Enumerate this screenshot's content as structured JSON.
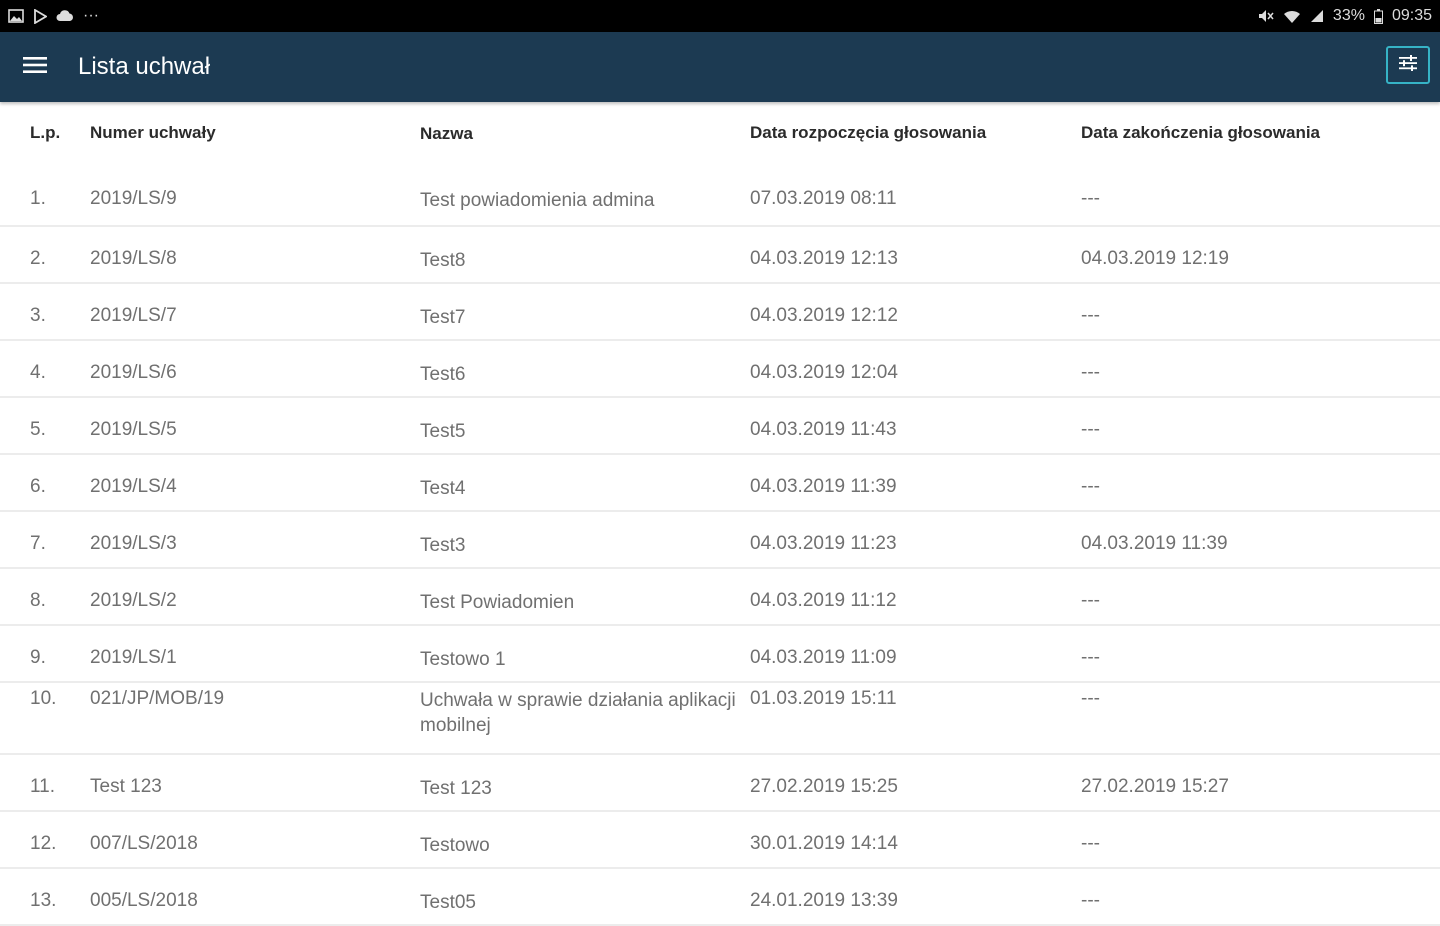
{
  "status_bar": {
    "left_icons": [
      "image-icon",
      "play-store-icon",
      "cloud-icon",
      "more-icon"
    ],
    "right_icons": [
      "mute-icon",
      "wifi-icon",
      "signal-icon"
    ],
    "battery": "33%",
    "time": "09:35",
    "more_glyph": "···"
  },
  "app_bar": {
    "title": "Lista uchwał",
    "background": "#1c3a52",
    "accent": "#36b3c6"
  },
  "table": {
    "headers": {
      "lp": "L.p.",
      "number": "Numer uchwały",
      "name": "Nazwa",
      "start": "Data rozpoczęcia głosowania",
      "end": "Data zakończenia głosowania"
    },
    "rows": [
      {
        "lp": "1.",
        "number": "2019/LS/9",
        "name": "Test powiadomienia admina",
        "start": "07.03.2019 08:11",
        "end": "---"
      },
      {
        "lp": "2.",
        "number": "2019/LS/8",
        "name": "Test8",
        "start": "04.03.2019 12:13",
        "end": "04.03.2019 12:19"
      },
      {
        "lp": "3.",
        "number": "2019/LS/7",
        "name": "Test7",
        "start": "04.03.2019 12:12",
        "end": "---"
      },
      {
        "lp": "4.",
        "number": "2019/LS/6",
        "name": "Test6",
        "start": "04.03.2019 12:04",
        "end": "---"
      },
      {
        "lp": "5.",
        "number": "2019/LS/5",
        "name": "Test5",
        "start": "04.03.2019 11:43",
        "end": "---"
      },
      {
        "lp": "6.",
        "number": "2019/LS/4",
        "name": "Test4",
        "start": "04.03.2019 11:39",
        "end": "---"
      },
      {
        "lp": "7.",
        "number": "2019/LS/3",
        "name": "Test3",
        "start": "04.03.2019 11:23",
        "end": "04.03.2019 11:39"
      },
      {
        "lp": "8.",
        "number": "2019/LS/2",
        "name": "Test Powiadomien",
        "start": "04.03.2019 11:12",
        "end": "---"
      },
      {
        "lp": "9.",
        "number": "2019/LS/1",
        "name": "Testowo 1",
        "start": "04.03.2019 11:09",
        "end": "---"
      },
      {
        "lp": "10.",
        "number": "021/JP/MOB/19",
        "name": "Uchwała w sprawie działania aplikacji mobilnej",
        "start": "01.03.2019 15:11",
        "end": "---"
      },
      {
        "lp": "11.",
        "number": "Test 123",
        "name": "Test 123",
        "start": "27.02.2019 15:25",
        "end": "27.02.2019 15:27"
      },
      {
        "lp": "12.",
        "number": "007/LS/2018",
        "name": "Testowo",
        "start": "30.01.2019 14:14",
        "end": "---"
      },
      {
        "lp": "13.",
        "number": "005/LS/2018",
        "name": "Test05",
        "start": "24.01.2019 13:39",
        "end": "---"
      }
    ]
  }
}
